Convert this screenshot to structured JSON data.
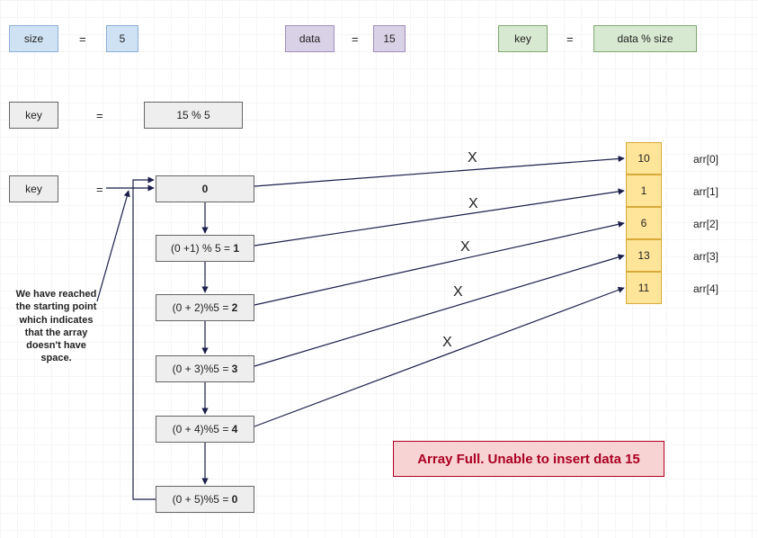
{
  "header": {
    "size_label": "size",
    "size_value": "5",
    "data_label": "data",
    "data_value": "15",
    "key_label": "key",
    "key_formula": "data % size"
  },
  "step1": {
    "key_label": "key",
    "expression": "15 % 5"
  },
  "step2": {
    "key_label": "key",
    "result": "0"
  },
  "probes": [
    {
      "expr_prefix": "(0 +1) % 5 = ",
      "expr_result": "1"
    },
    {
      "expr_prefix": "(0 + 2)%5 = ",
      "expr_result": "2"
    },
    {
      "expr_prefix": "(0 + 3)%5 = ",
      "expr_result": "3"
    },
    {
      "expr_prefix": "(0 + 4)%5 = ",
      "expr_result": "4"
    },
    {
      "expr_prefix": "(0 + 5)%5 = ",
      "expr_result": "0"
    }
  ],
  "collision_marks": [
    "X",
    "X",
    "X",
    "X",
    "X"
  ],
  "array": [
    {
      "value": "10",
      "label": "arr[0]"
    },
    {
      "value": "1",
      "label": "arr[1]"
    },
    {
      "value": "6",
      "label": "arr[2]"
    },
    {
      "value": "13",
      "label": "arr[3]"
    },
    {
      "value": "11",
      "label": "arr[4]"
    }
  ],
  "note_text": "We have reached the starting point which indicates that  the  array  doesn't have space.",
  "alert_text": "Array Full. Unable to insert data 15",
  "equals": "=",
  "colors": {
    "blue_fill": "#cfe2f3",
    "purple_fill": "#d9d2e7",
    "green_fill": "#d8e9d2",
    "yellow_fill": "#ffe599",
    "grey_fill": "#eeeeee",
    "yellow_border": "#d9a93a"
  }
}
